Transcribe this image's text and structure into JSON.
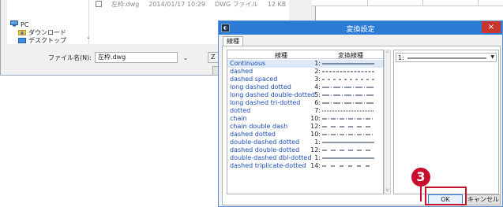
{
  "file_dialog": {
    "file_row": {
      "name": "左枠.dwg",
      "date": "2014/01/17 10:29",
      "type": "DWG ファイル",
      "size": "12 KB"
    },
    "tree": [
      {
        "label": "PC",
        "icon": "computer-icon"
      },
      {
        "label": "ダウンロード",
        "icon": "download-folder-icon"
      },
      {
        "label": "デスクトップ",
        "icon": "desktop-folder-icon"
      }
    ],
    "filename_label": "ファイル名(N):",
    "filename_value": "左枠.dwg",
    "partial_label": "Z"
  },
  "dialog": {
    "title": "変換設定",
    "close_glyph": "×",
    "app_icon_glyph": "◐",
    "tab_label": "線種",
    "col_linetype": "線種",
    "col_converted": "変換線種",
    "rows": [
      {
        "name": "Continuous",
        "num": "1:",
        "pattern": "solid"
      },
      {
        "name": "dashed",
        "num": "2:",
        "pattern": "dashed"
      },
      {
        "name": "dashed spaced",
        "num": "3:",
        "pattern": "spaced"
      },
      {
        "name": "long dashed dotted",
        "num": "4:",
        "pattern": "dashdot"
      },
      {
        "name": "long dashed double-dotted",
        "num": "5:",
        "pattern": "dashdot"
      },
      {
        "name": "long dashed tri-dotted",
        "num": "6:",
        "pattern": "dashdot"
      },
      {
        "name": "dotted",
        "num": "7:",
        "pattern": "dotted"
      },
      {
        "name": "chain",
        "num": "10:",
        "pattern": "chain"
      },
      {
        "name": "chain double dash",
        "num": "12:",
        "pattern": "long"
      },
      {
        "name": "dashed dotted",
        "num": "10:",
        "pattern": "chain"
      },
      {
        "name": "double-dashed dotted",
        "num": "1:",
        "pattern": "solid"
      },
      {
        "name": "dashed double-dotted",
        "num": "12:",
        "pattern": "long"
      },
      {
        "name": "double-dashed dbl-dotted",
        "num": "1:",
        "pattern": "solid"
      },
      {
        "name": "dashed triplicate-dotted",
        "num": "14:",
        "pattern": "long2"
      }
    ],
    "preview_num": "1:",
    "ok_label": "OK",
    "cancel_label": "キャンセル"
  },
  "annotation": {
    "step_number": "3"
  },
  "colors": {
    "accent": "#2b7ad6",
    "callout": "#c8102e",
    "link_text": "#1b4db3"
  }
}
